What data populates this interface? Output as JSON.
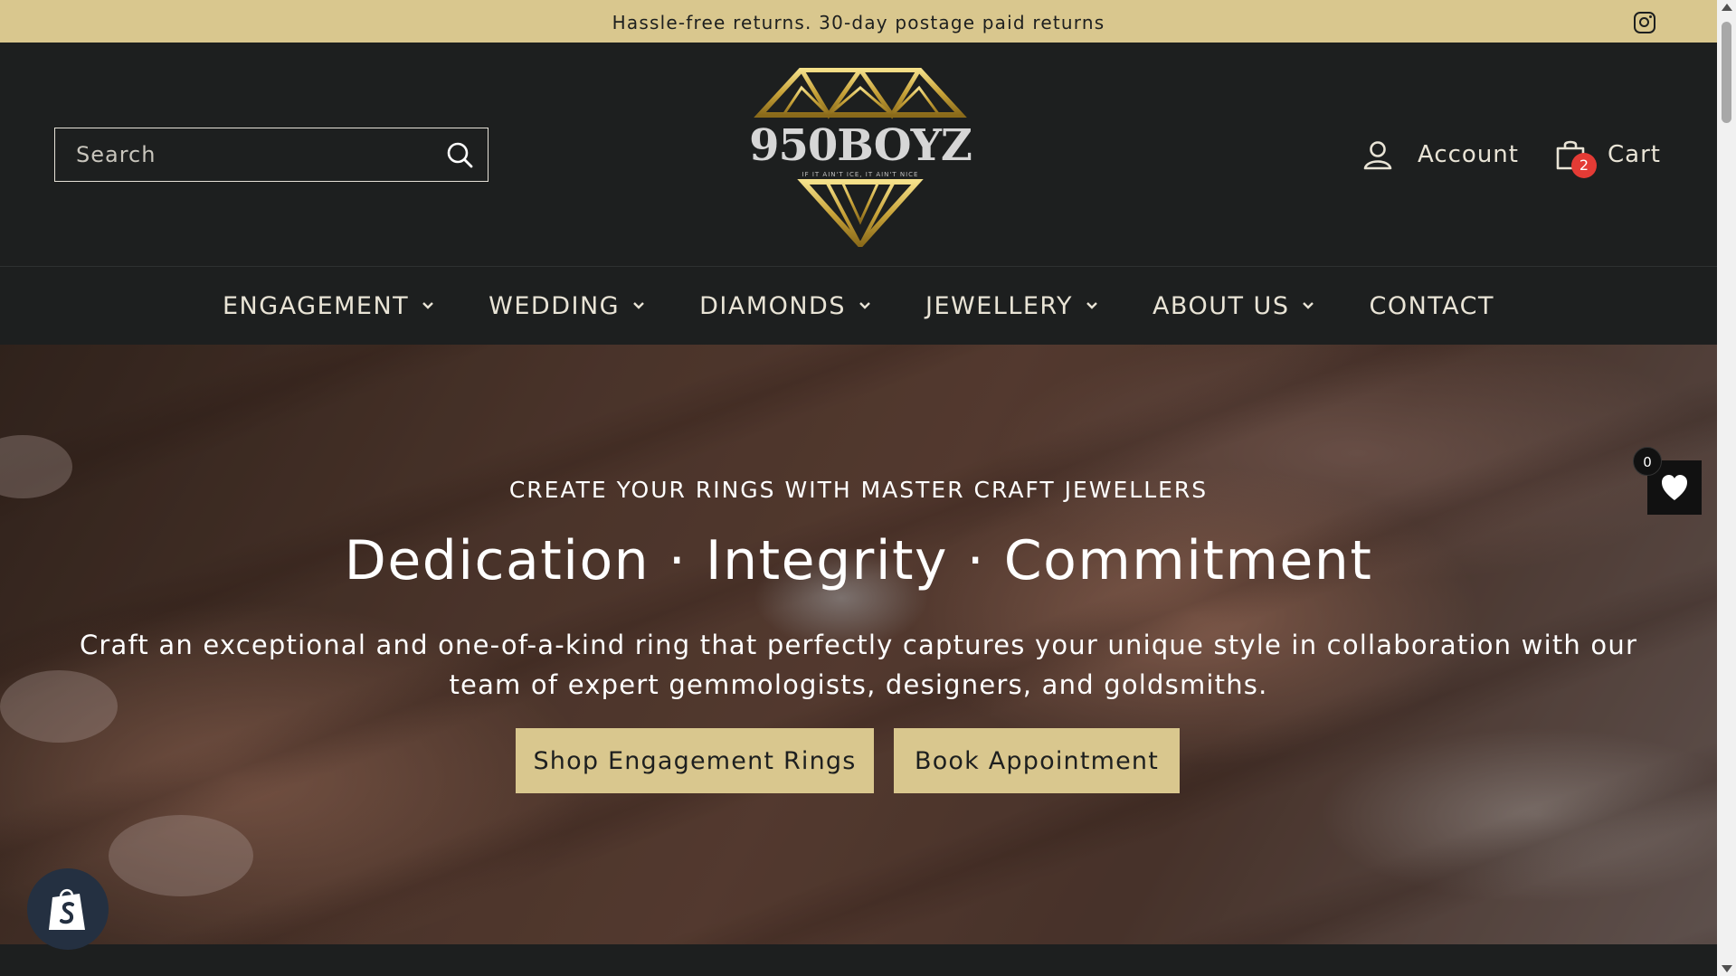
{
  "announcement": {
    "text": "Hassle-free returns. 30-day postage paid returns",
    "social_icon": "instagram-icon"
  },
  "header": {
    "search": {
      "placeholder": "Search",
      "value": ""
    },
    "logo": {
      "brand": "950BOYZ",
      "tagline": "IF IT AIN'T ICE, IT AIN'T NICE"
    },
    "account_label": "Account",
    "cart_label": "Cart",
    "cart_count": "2"
  },
  "nav": {
    "items": [
      {
        "label": "ENGAGEMENT",
        "has_dropdown": true
      },
      {
        "label": "WEDDING",
        "has_dropdown": true
      },
      {
        "label": "DIAMONDS",
        "has_dropdown": true
      },
      {
        "label": "JEWELLERY",
        "has_dropdown": true
      },
      {
        "label": "ABOUT US",
        "has_dropdown": true
      },
      {
        "label": "CONTACT",
        "has_dropdown": false
      }
    ]
  },
  "hero": {
    "eyebrow": "CREATE YOUR RINGS WITH MASTER CRAFT JEWELLERS",
    "title": "Dedication · Integrity · Commitment",
    "text": "Craft an exceptional and one-of-a-kind ring that perfectly captures your unique style in collaboration with our team of expert gemmologists, designers, and goldsmiths.",
    "buttons": {
      "shop": "Shop Engagement Rings",
      "book": "Book Appointment"
    }
  },
  "wishlist": {
    "count": "0",
    "icon": "heart-icon"
  },
  "colors": {
    "accent": "#d9c78e",
    "background": "#1d1f1f",
    "badge": "#e43b35"
  }
}
